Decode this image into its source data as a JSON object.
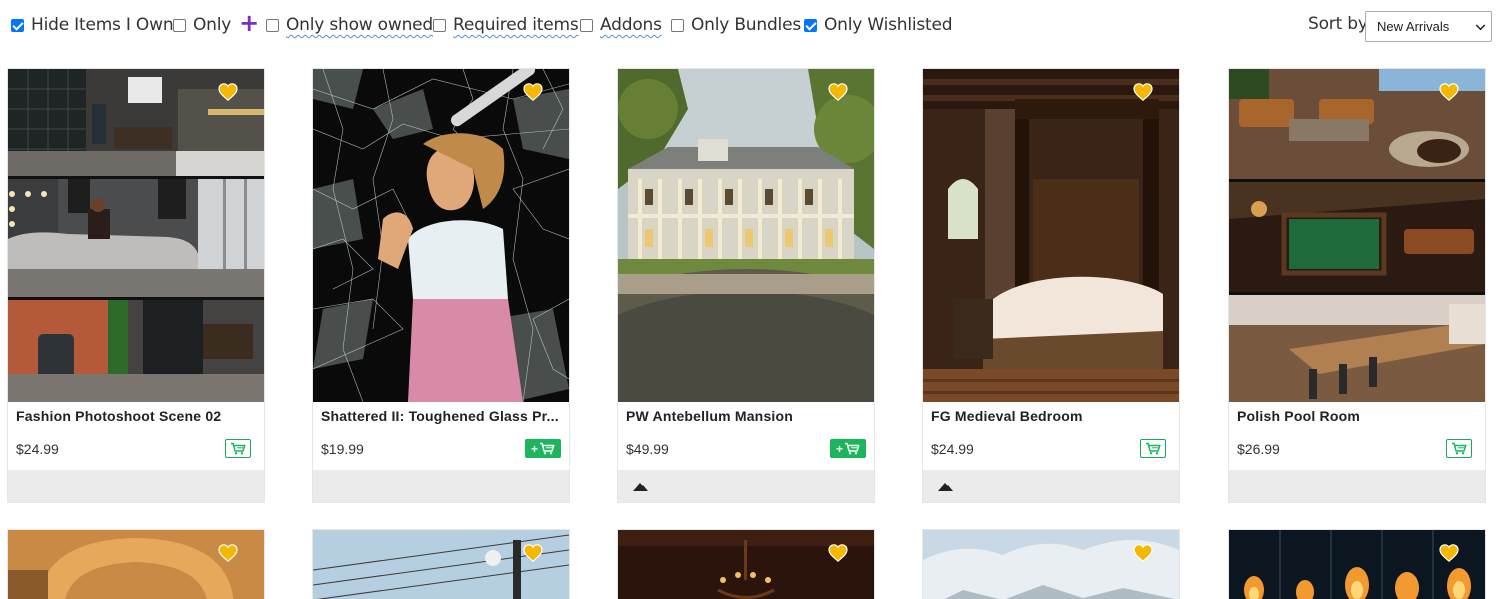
{
  "filters": [
    {
      "label": "Hide Items I Own",
      "checked": true
    },
    {
      "label": "Only",
      "checked": false
    },
    {
      "label": "Only show owned",
      "checked": false
    },
    {
      "label": "Required items",
      "checked": false
    },
    {
      "label": "Addons",
      "checked": false
    },
    {
      "label": "Only Bundles",
      "checked": false
    },
    {
      "label": "Only Wishlisted",
      "checked": true
    }
  ],
  "sort": {
    "label": "Sort by",
    "selected": "New Arrivals"
  },
  "products": [
    {
      "title": "Fashion Photoshoot Scene 02",
      "price": "$24.99",
      "cart": "outline",
      "footer_icon": false
    },
    {
      "title": "Shattered II: Toughened Glass Pr...",
      "price": "$19.99",
      "cart": "plus",
      "footer_icon": false
    },
    {
      "title": "PW Antebellum Mansion",
      "price": "$49.99",
      "cart": "plus",
      "footer_icon": true
    },
    {
      "title": "FG Medieval Bedroom",
      "price": "$24.99",
      "cart": "outline",
      "footer_icon": true
    },
    {
      "title": "Polish Pool Room",
      "price": "$26.99",
      "cart": "outline",
      "footer_icon": false
    }
  ],
  "colors": {
    "heart": "#f5b800",
    "cart_green": "#1ab55c",
    "plus_purple": "#7b2fbe",
    "checkbox_blue": "#0075ff"
  },
  "icons": {
    "heart": "heart-icon",
    "cart": "cart-icon",
    "plus": "plus-icon",
    "footer": "mountain-icon"
  }
}
